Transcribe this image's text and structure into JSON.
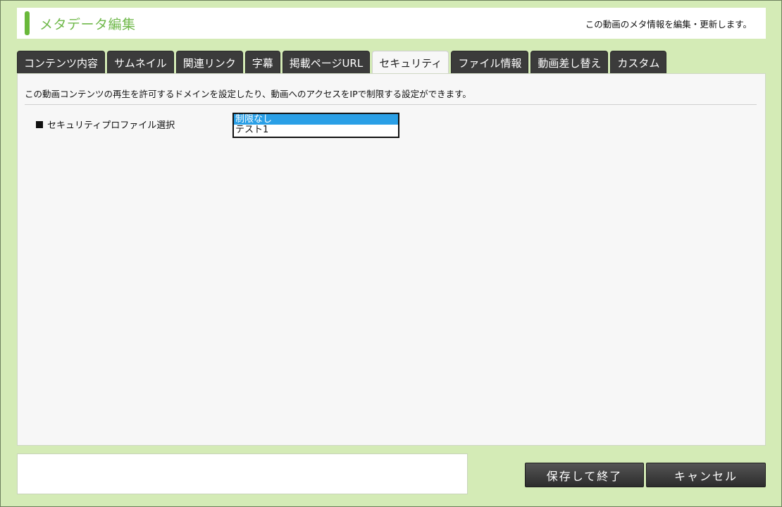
{
  "header": {
    "title": "メタデータ編集",
    "description": "この動画のメタ情報を編集・更新します。"
  },
  "tabs": [
    {
      "label": "コンテンツ内容",
      "active": false
    },
    {
      "label": "サムネイル",
      "active": false
    },
    {
      "label": "関連リンク",
      "active": false
    },
    {
      "label": "字幕",
      "active": false
    },
    {
      "label": "掲載ページURL",
      "active": false
    },
    {
      "label": "セキュリティ",
      "active": true
    },
    {
      "label": "ファイル情報",
      "active": false
    },
    {
      "label": "動画差し替え",
      "active": false
    },
    {
      "label": "カスタム",
      "active": false
    }
  ],
  "panel": {
    "description": "この動画コンテンツの再生を許可するドメインを設定したり、動画へのアクセスをIPで制限する設定ができます。",
    "field_label": "セキュリティプロファイル選択",
    "options": [
      {
        "label": "制限なし",
        "selected": true
      },
      {
        "label": "テスト1",
        "selected": false
      }
    ]
  },
  "footer": {
    "message": "",
    "save_label": "保存して終了",
    "cancel_label": "キャンセル"
  },
  "colors": {
    "background": "#d4ebb6",
    "accent": "#69b83a",
    "title_text": "#6fb84a",
    "tab_dark": "#3b3b3b",
    "selected_option": "#2a9fe6"
  }
}
